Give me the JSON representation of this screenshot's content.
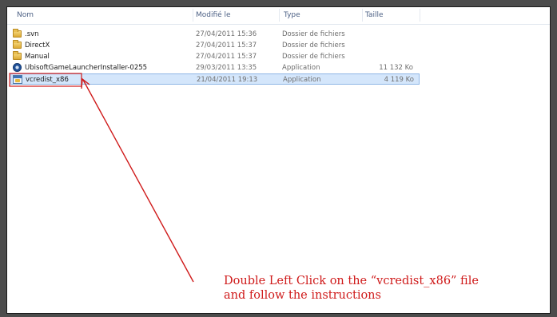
{
  "columns": {
    "name": "Nom",
    "modified": "Modifié le",
    "type": "Type",
    "size": "Taille"
  },
  "files": [
    {
      "name": ".svn",
      "modified": "27/04/2011 15:36",
      "type": "Dossier de fichiers",
      "size": "",
      "icon": "folder-icon"
    },
    {
      "name": "DirectX",
      "modified": "27/04/2011 15:37",
      "type": "Dossier de fichiers",
      "size": "",
      "icon": "folder-icon"
    },
    {
      "name": "Manual",
      "modified": "27/04/2011 15:37",
      "type": "Dossier de fichiers",
      "size": "",
      "icon": "folder-icon"
    },
    {
      "name": "UbisoftGameLauncherInstaller-0255",
      "modified": "29/03/2011 13:35",
      "type": "Application",
      "size": "11 132 Ko",
      "icon": "ubisoft-launcher-icon"
    },
    {
      "name": "vcredist_x86",
      "modified": "21/04/2011 19:13",
      "type": "Application",
      "size": "4 119 Ko",
      "icon": "installer-app-icon",
      "selected": true
    }
  ],
  "annotation": {
    "line1": "Double Left Click on the “vcredist_x86” file",
    "line2": "and follow the instructions",
    "color": "#cf1a1a"
  },
  "colors": {
    "header_text": "#4d6185",
    "selection_bg": "#d4e6fb",
    "selection_border": "#8fb6e6",
    "backdrop": "#4c4c4c"
  }
}
